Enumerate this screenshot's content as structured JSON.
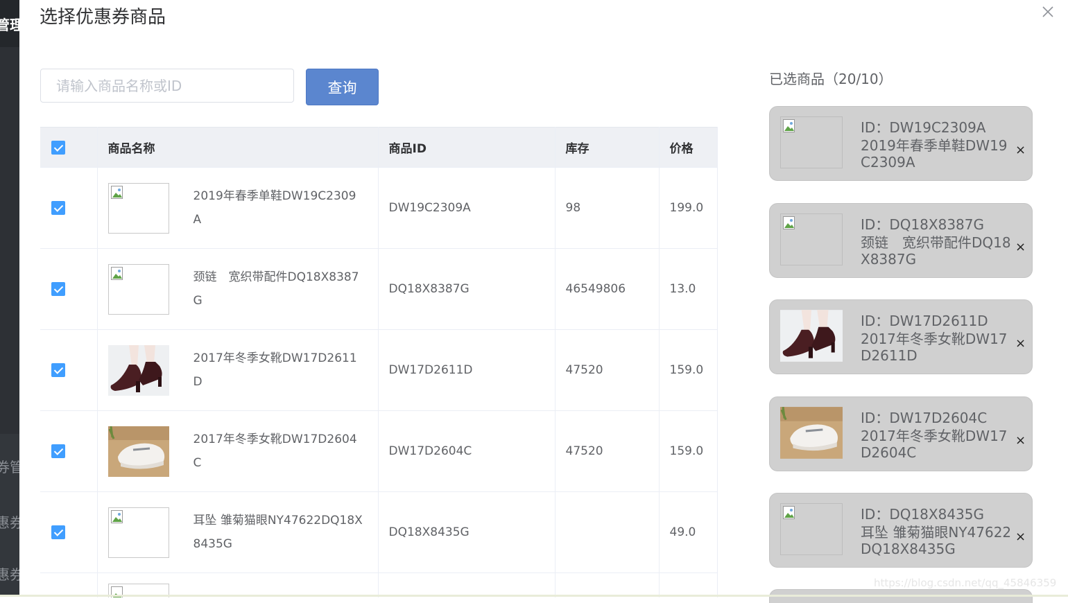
{
  "background": {
    "sidebar_texts": [
      "管理",
      "券管",
      "惠券",
      "惠券"
    ]
  },
  "dialog": {
    "title": "选择优惠券商品",
    "close_icon": "close-icon"
  },
  "search": {
    "placeholder": "请输入商品名称或ID",
    "value": "",
    "button_label": "查询"
  },
  "table": {
    "columns": [
      "商品名称",
      "商品ID",
      "库存",
      "价格"
    ],
    "header_checked": true,
    "rows": [
      {
        "checked": true,
        "image": "broken-image-icon",
        "name": "2019年春季单鞋DW19C2309A",
        "id": "DW19C2309A",
        "stock": "98",
        "price": "199.0"
      },
      {
        "checked": true,
        "image": "broken-image-icon",
        "name": "颈链　宽织带配件DQ18X8387G",
        "id": "DQ18X8387G",
        "stock": "46549806",
        "price": "13.0"
      },
      {
        "checked": true,
        "image": "boot-photo",
        "name": "2017年冬季女靴DW17D2611D",
        "id": "DW17D2611D",
        "stock": "47520",
        "price": "159.0"
      },
      {
        "checked": true,
        "image": "sneaker-photo",
        "name": "2017年冬季女靴DW17D2604C",
        "id": "DW17D2604C",
        "stock": "47520",
        "price": "159.0"
      },
      {
        "checked": true,
        "image": "broken-image-icon",
        "name": "耳坠 雏菊猫眼NY47622DQ18X8435G",
        "id": "DQ18X8435G",
        "stock": "",
        "price": "49.0"
      }
    ]
  },
  "selected": {
    "title": "已选商品（20/10）",
    "id_prefix": "ID：",
    "remove_label": "×",
    "items": [
      {
        "id": "DW19C2309A",
        "name": "2019年春季单鞋DW19C2309A",
        "image": "broken-image-icon"
      },
      {
        "id": "DQ18X8387G",
        "name": "颈链　宽织带配件DQ18X8387G",
        "image": "broken-image-icon"
      },
      {
        "id": "DW17D2611D",
        "name": "2017年冬季女靴DW17D2611D",
        "image": "boot-photo"
      },
      {
        "id": "DW17D2604C",
        "name": "2017年冬季女靴DW17D2604C",
        "image": "sneaker-photo"
      },
      {
        "id": "DQ18X8435G",
        "name": "耳坠 雏菊猫眼NY47622DQ18X8435G",
        "image": "broken-image-icon"
      }
    ]
  },
  "watermark": "https://blog.csdn.net/qq_45846359",
  "colors": {
    "primary_button": "#5b86cf",
    "checkbox": "#409eff",
    "card_bg": "#d0d0d0",
    "header_bg": "#eef0f4"
  }
}
